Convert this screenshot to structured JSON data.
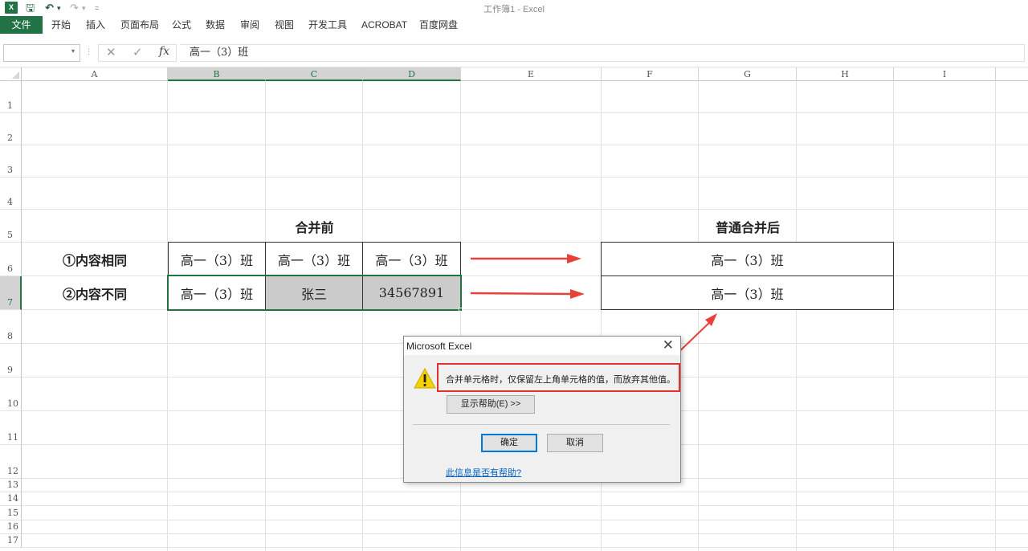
{
  "window": {
    "title": "工作簿1 - Excel",
    "app_icon_text": "X"
  },
  "quick_access": {
    "save_glyph": "🖫",
    "undo_glyph": "↶",
    "redo_glyph": "↷",
    "dropdown_glyph": "▾",
    "more_glyph": "="
  },
  "ribbon": {
    "tabs": [
      "文件",
      "开始",
      "插入",
      "页面布局",
      "公式",
      "数据",
      "审阅",
      "视图",
      "开发工具",
      "ACROBAT",
      "百度网盘"
    ]
  },
  "formula_bar": {
    "name_box": "",
    "cancel_glyph": "✕",
    "enter_glyph": "✓",
    "fx": "fx",
    "value": "高一（3）班"
  },
  "grid": {
    "columns": [
      "A",
      "B",
      "C",
      "D",
      "E",
      "F",
      "G",
      "H",
      "I"
    ],
    "selected_columns": [
      "B",
      "C",
      "D"
    ],
    "rows": [
      "1",
      "2",
      "3",
      "4",
      "5",
      "6",
      "7",
      "8",
      "9",
      "10",
      "11",
      "12",
      "13",
      "14",
      "15",
      "16",
      "17"
    ],
    "selected_rows": [
      "7"
    ]
  },
  "table": {
    "before_title": "合并前",
    "after_title": "普通合并后",
    "row_labels": [
      "①内容相同",
      "②内容不同"
    ],
    "row6": [
      "高一（3）班",
      "高一（3）班",
      "高一（3）班"
    ],
    "row7": [
      "高一（3）班",
      "张三",
      "34567891"
    ],
    "merged6": "高一（3）班",
    "merged7": "高一（3）班"
  },
  "colors": {
    "excel_green": "#217346",
    "arrow_red": "#e8413a",
    "highlight_red": "#e03030",
    "selected_cell_gray": "#cbcbcb"
  },
  "dialog": {
    "title": "Microsoft Excel",
    "close_glyph": "✕",
    "icon": "warning-icon",
    "message": "合并单元格时，仅保留左上角单元格的值，而放弃其他值。",
    "help_button": "显示帮助(E) >>",
    "ok_button": "确定",
    "cancel_button": "取消",
    "feedback_link": "此信息是否有帮助?"
  }
}
